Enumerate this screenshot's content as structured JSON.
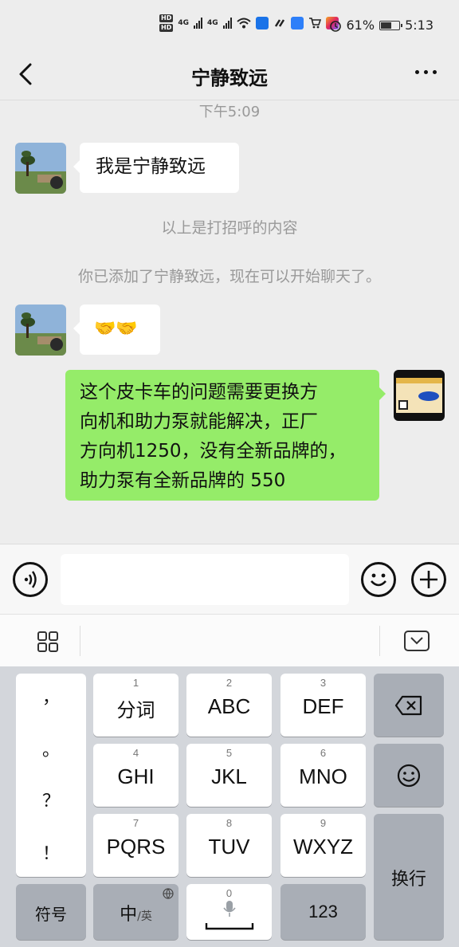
{
  "status_bar": {
    "hd_top": "HD",
    "hd_bottom": "HD",
    "net1": "4G",
    "net2": "4G",
    "battery_text": "61%",
    "battery_level": 0.61,
    "time": "5:13"
  },
  "nav": {
    "title": "宁静致远"
  },
  "chat": {
    "timestamp": "下午5:09",
    "messages": [
      {
        "sender": "contact",
        "text": "我是宁静致远"
      },
      {
        "sender": "system",
        "text": "以上是打招呼的内容"
      },
      {
        "sender": "system",
        "text": "你已添加了宁静致远，现在可以开始聊天了。"
      },
      {
        "sender": "contact",
        "text": "🤝🤝"
      },
      {
        "sender": "me",
        "lines": [
          "这个皮卡车的问题需要更换方",
          "向机和助力泵就能解决，正厂",
          "方向机1250，没有全新品牌的，",
          "助力泵有全新品牌的 550"
        ]
      }
    ]
  },
  "input": {
    "value": ""
  },
  "keyboard": {
    "punctuation": [
      "，",
      "。",
      "？",
      "！"
    ],
    "keys": [
      {
        "num": "1",
        "label": "分词"
      },
      {
        "num": "2",
        "label": "ABC"
      },
      {
        "num": "3",
        "label": "DEF"
      },
      {
        "num": "4",
        "label": "GHI"
      },
      {
        "num": "5",
        "label": "JKL"
      },
      {
        "num": "6",
        "label": "MNO"
      },
      {
        "num": "7",
        "label": "PQRS"
      },
      {
        "num": "8",
        "label": "TUV"
      },
      {
        "num": "9",
        "label": "WXYZ"
      }
    ],
    "symbol_label": "符号",
    "lang_main": "中",
    "lang_alt": "/英",
    "space_num": "0",
    "num_label": "123",
    "enter_label": "换行"
  },
  "colors": {
    "background": "#ededed",
    "bubble_me": "#95ec69",
    "bubble_contact": "#ffffff",
    "keyboard_bg": "#d3d6db"
  }
}
